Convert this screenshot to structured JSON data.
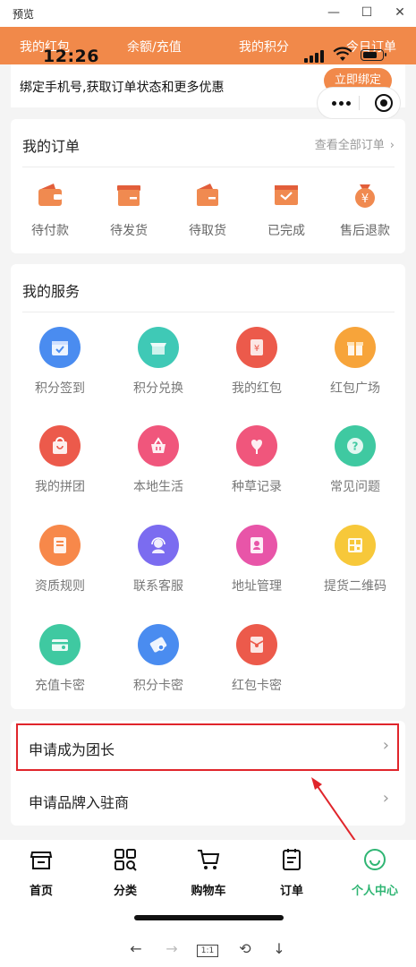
{
  "window": {
    "title": "预览",
    "controls": [
      "minimize-icon",
      "maximize-icon",
      "close-icon"
    ]
  },
  "status_bar": {
    "time": "12:26"
  },
  "top_nav": {
    "items": [
      "我的红包",
      "余额/充值",
      "我的积分",
      "今日订单"
    ]
  },
  "bind_banner": {
    "text": "绑定手机号,获取订单状态和更多优惠",
    "button": "立即绑定"
  },
  "orders": {
    "title": "我的订单",
    "view_all": "查看全部订单",
    "items": [
      {
        "label": "待付款",
        "icon": "wallet-icon"
      },
      {
        "label": "待发货",
        "icon": "package-icon"
      },
      {
        "label": "待取货",
        "icon": "pickup-bag-icon"
      },
      {
        "label": "已完成",
        "icon": "completed-mail-icon"
      },
      {
        "label": "售后退款",
        "icon": "refund-yen-icon"
      }
    ]
  },
  "services": {
    "title": "我的服务",
    "items": [
      {
        "label": "积分签到",
        "icon": "calendar-check-icon",
        "color": "#4a8cf0"
      },
      {
        "label": "积分兑换",
        "icon": "exchange-store-icon",
        "color": "#3fc9b6"
      },
      {
        "label": "我的红包",
        "icon": "red-envelope-icon",
        "color": "#ec5a4b"
      },
      {
        "label": "红包广场",
        "icon": "gift-icon",
        "color": "#f7a43a"
      },
      {
        "label": "我的拼团",
        "icon": "shopping-bag-icon",
        "color": "#ec5a4b"
      },
      {
        "label": "本地生活",
        "icon": "basket-icon",
        "color": "#f0567c"
      },
      {
        "label": "种草记录",
        "icon": "heart-plant-icon",
        "color": "#f0567c"
      },
      {
        "label": "常见问题",
        "icon": "question-icon",
        "color": "#3fc9a1"
      },
      {
        "label": "资质规则",
        "icon": "certificate-icon",
        "color": "#f7884a"
      },
      {
        "label": "联系客服",
        "icon": "customer-service-icon",
        "color": "#7b6cf0"
      },
      {
        "label": "地址管理",
        "icon": "address-book-icon",
        "color": "#e855a8"
      },
      {
        "label": "提货二维码",
        "icon": "qr-code-icon",
        "color": "#f7c83a"
      },
      {
        "label": "充值卡密",
        "icon": "recharge-card-icon",
        "color": "#3fc9a1"
      },
      {
        "label": "积分卡密",
        "icon": "points-card-icon",
        "color": "#4a8cf0"
      },
      {
        "label": "红包卡密",
        "icon": "envelope-card-icon",
        "color": "#ec5a4b"
      }
    ]
  },
  "list": {
    "items": [
      {
        "label": "申请成为团长"
      },
      {
        "label": "申请品牌入驻商"
      }
    ]
  },
  "tab_bar": {
    "items": [
      {
        "label": "首页",
        "icon": "store-icon",
        "active": false
      },
      {
        "label": "分类",
        "icon": "category-grid-icon",
        "active": false
      },
      {
        "label": "购物车",
        "icon": "cart-icon",
        "active": false
      },
      {
        "label": "订单",
        "icon": "order-list-icon",
        "active": false
      },
      {
        "label": "个人中心",
        "icon": "smile-user-icon",
        "active": true
      }
    ]
  },
  "browser_toolbar": {
    "zoom_label": "1:1"
  },
  "colors": {
    "accent": "#f1894a",
    "active_tab": "#2fb573",
    "highlight": "#e0252b"
  }
}
